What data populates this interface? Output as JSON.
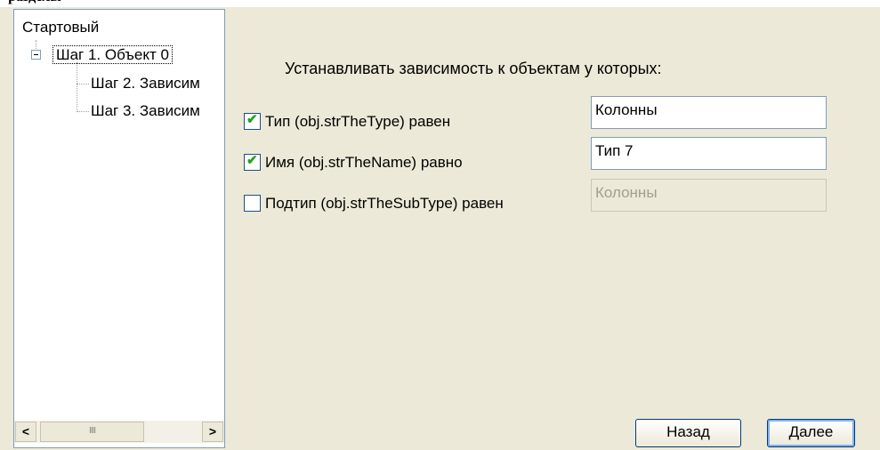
{
  "top_text": "<разделы> (колонн).",
  "tree": {
    "root_label": "Стартовый",
    "items": [
      {
        "label": "Шаг 1. Объект 0",
        "selected": true
      },
      {
        "label": "Шаг 2. Зависим"
      },
      {
        "label": "Шаг 3. Зависим"
      }
    ],
    "expander_icon": "minus-icon"
  },
  "scrollbar": {
    "left_arrow": "<",
    "right_arrow": ">",
    "thumb_grip": "IIII"
  },
  "main": {
    "heading": "Устанавливать зависимость к объектам у которых:",
    "rows": [
      {
        "label": "Тип (obj.strTheType) равен",
        "checked": true,
        "value": "Колонны"
      },
      {
        "label": "Имя (obj.strTheName) равно",
        "checked": true,
        "value": "Тип 7"
      },
      {
        "label": "Подтип (obj.strTheSubType) равен",
        "checked": false,
        "value": "Колонны"
      }
    ],
    "check_mark": "✔"
  },
  "buttons": {
    "back": "Назад",
    "next": "Далее"
  },
  "colors": {
    "dialog_bg": "#ece9d8",
    "check_green": "#21a121",
    "border_blue": "#7f9db9"
  }
}
